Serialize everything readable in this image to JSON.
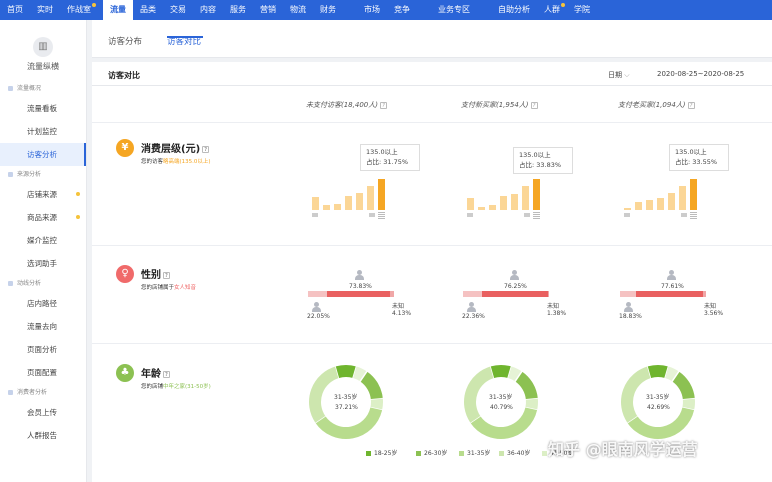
{
  "nav": [
    {
      "label": "首页"
    },
    {
      "label": "实时"
    },
    {
      "label": "作战室",
      "dot": true
    },
    {
      "label": "流量",
      "active": true
    },
    {
      "label": "品类"
    },
    {
      "label": "交易"
    },
    {
      "label": "内容"
    },
    {
      "label": "服务"
    },
    {
      "label": "营销"
    },
    {
      "label": "物流"
    },
    {
      "label": "财务"
    },
    {
      "label": "市场"
    },
    {
      "label": "竞争"
    },
    {
      "label": "业务专区"
    },
    {
      "label": "自助分析"
    },
    {
      "label": "人群",
      "dot": true
    },
    {
      "label": "学院"
    }
  ],
  "sidebar": {
    "logo_label": "流量纵横",
    "entries": [
      {
        "type": "group",
        "label": "流量概况"
      },
      {
        "type": "item",
        "label": "流量看板"
      },
      {
        "type": "item",
        "label": "计划监控"
      },
      {
        "type": "item",
        "label": "访客分析",
        "active": true
      },
      {
        "type": "group",
        "label": "来源分析"
      },
      {
        "type": "item",
        "label": "店铺来源",
        "dot": true
      },
      {
        "type": "item",
        "label": "商品来源",
        "dot": true
      },
      {
        "type": "item",
        "label": "媒介监控"
      },
      {
        "type": "item",
        "label": "选词助手"
      },
      {
        "type": "group",
        "label": "动线分析"
      },
      {
        "type": "item",
        "label": "店内路径"
      },
      {
        "type": "item",
        "label": "流量去向"
      },
      {
        "type": "item",
        "label": "页面分析"
      },
      {
        "type": "item",
        "label": "页面配置"
      },
      {
        "type": "group",
        "label": "消费者分析"
      },
      {
        "type": "item",
        "label": "会员上传"
      },
      {
        "type": "item",
        "label": "人群报告"
      }
    ]
  },
  "tabs": {
    "distribution": "访客分布",
    "comparison": "访客对比"
  },
  "panel": {
    "title": "访客对比",
    "date_label": "日期",
    "date_range": "2020-08-25~2020-08-25"
  },
  "columns": [
    {
      "label": "未支付访客(18,400人)"
    },
    {
      "label": "支付新买家(1,954人)"
    },
    {
      "label": "支付老买家(1,094人)"
    }
  ],
  "sections": {
    "consumption": {
      "icon": "¥",
      "title": "消费层级(元)",
      "sub_prefix": "您的访客",
      "sub_highlight": "略高端(135.0以上)",
      "color": "#f5a623"
    },
    "gender": {
      "icon": "♀",
      "title": "性别",
      "sub_prefix": "您的店铺属于",
      "sub_highlight": "女人知音",
      "color": "#f06a6a"
    },
    "age": {
      "icon": "♣",
      "title": "年龄",
      "sub_prefix": "您的店铺",
      "sub_highlight": "中年之家(31-50岁)",
      "color": "#8cc152"
    }
  },
  "consumption_tooltips": [
    {
      "range": "135.0以上",
      "share": "占比: 31.75%"
    },
    {
      "range": "135.0以上",
      "share": "占比: 33.83%"
    },
    {
      "range": "135.0以上",
      "share": "占比: 33.55%"
    }
  ],
  "consumption_bars": [
    [
      0.38,
      0.14,
      0.18,
      0.42,
      0.5,
      0.72,
      0.92
    ],
    [
      0.35,
      0.08,
      0.16,
      0.4,
      0.48,
      0.7,
      0.92
    ],
    [
      0.07,
      0.24,
      0.3,
      0.36,
      0.5,
      0.72,
      0.92
    ]
  ],
  "gender": [
    {
      "female": "73.83%",
      "male": "22.05%",
      "unknown_label": "未知",
      "unknown": "4.13%",
      "female_frac": 0.7383,
      "male_frac": 0.2205
    },
    {
      "female": "76.25%",
      "male": "22.36%",
      "unknown_label": "未知",
      "unknown": "1.38%",
      "female_frac": 0.7625,
      "male_frac": 0.2236
    },
    {
      "female": "77.61%",
      "male": "18.83%",
      "unknown_label": "未知",
      "unknown": "3.56%",
      "female_frac": 0.7761,
      "male_frac": 0.1883
    }
  ],
  "age": [
    {
      "center_label": "31-35岁",
      "center_value": "37.21%"
    },
    {
      "center_label": "31-35岁",
      "center_value": "40.79%"
    },
    {
      "center_label": "31-35岁",
      "center_value": "42.69%"
    }
  ],
  "age_legend": [
    {
      "label": "18-25岁",
      "color": "#6fb52e"
    },
    {
      "label": "26-30岁",
      "color": "#8cc152"
    },
    {
      "label": "31-35岁",
      "color": "#b8dc8d"
    },
    {
      "label": "36-40岁",
      "color": "#cde6ae"
    },
    {
      "label": "41-50岁",
      "color": "#dcefc6"
    }
  ],
  "watermark": "知乎 @眼南风学运营"
}
